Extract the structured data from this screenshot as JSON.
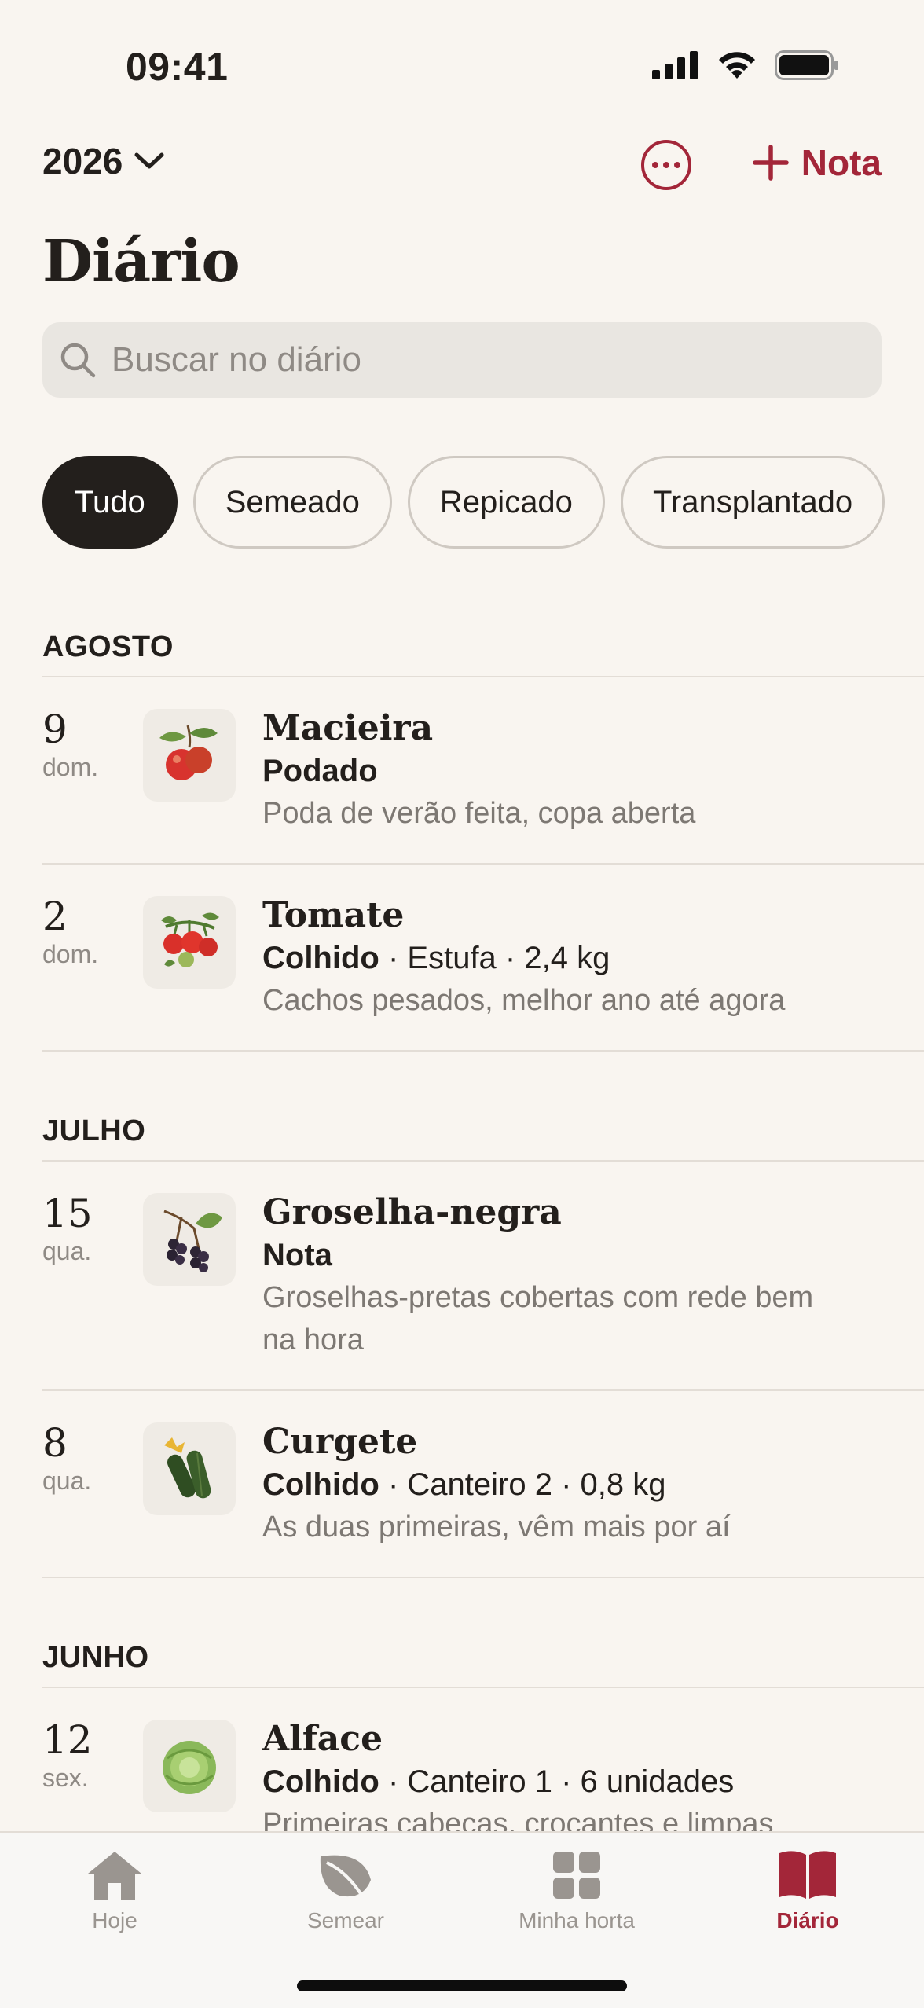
{
  "status_bar": {
    "time": "09:41"
  },
  "header": {
    "year": "2026",
    "add_note_label": "Nota",
    "title": "Diário"
  },
  "search": {
    "placeholder": "Buscar no diário"
  },
  "filters": [
    "Tudo",
    "Semeado",
    "Repicado",
    "Transplantado"
  ],
  "journal": {
    "months": [
      {
        "name": "AGOSTO",
        "entries": [
          {
            "day": "9",
            "weekday": "dom.",
            "plant": "Macieira",
            "icon": "apple-icon",
            "action": "Podado",
            "details": "",
            "note": "Poda de verão feita, copa aberta"
          },
          {
            "day": "2",
            "weekday": "dom.",
            "plant": "Tomate",
            "icon": "tomato-icon",
            "action": "Colhido",
            "details": " · Estufa · 2,4 kg",
            "note": "Cachos pesados, melhor ano até agora"
          }
        ]
      },
      {
        "name": "JULHO",
        "entries": [
          {
            "day": "15",
            "weekday": "qua.",
            "plant": "Groselha-negra",
            "icon": "blackcurrant-icon",
            "action": "Nota",
            "details": "",
            "note": "Groselhas-pretas cobertas com rede bem na hora"
          },
          {
            "day": "8",
            "weekday": "qua.",
            "plant": "Curgete",
            "icon": "courgette-icon",
            "action": "Colhido",
            "details": " · Canteiro 2 · 0,8 kg",
            "note": "As duas primeiras, vêm mais por aí"
          }
        ]
      },
      {
        "name": "JUNHO",
        "entries": [
          {
            "day": "12",
            "weekday": "sex.",
            "plant": "Alface",
            "icon": "lettuce-icon",
            "action": "Colhido",
            "details": " · Canteiro 1 · 6 unidades",
            "note": "Primeiras cabeças, crocantes e limpas"
          }
        ]
      }
    ]
  },
  "tabs": [
    {
      "label": "Hoje",
      "icon": "home-icon"
    },
    {
      "label": "Semear",
      "icon": "leaf-icon"
    },
    {
      "label": "Minha horta",
      "icon": "grid-icon"
    },
    {
      "label": "Diário",
      "icon": "book-icon",
      "active": true
    }
  ],
  "colors": {
    "accent": "#a32639",
    "background": "#f9f5f0",
    "chip_active": "#231f1c"
  }
}
